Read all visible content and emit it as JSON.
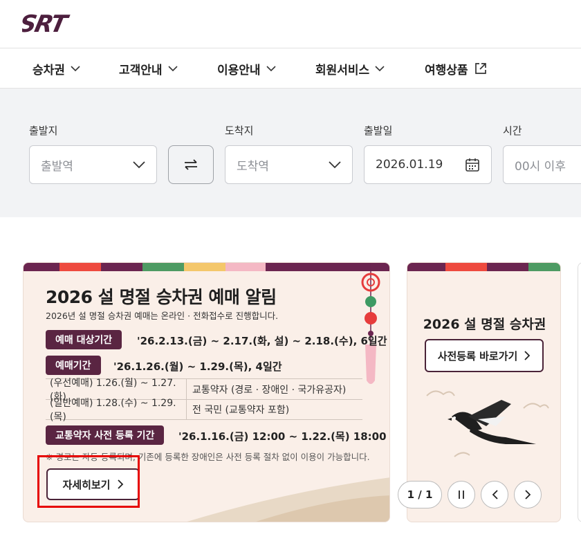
{
  "brand": {
    "logo_text": "SRT",
    "logo_color": "#4d1f3e"
  },
  "gnb": [
    {
      "label": "승차권",
      "icon": "chevron-down-icon"
    },
    {
      "label": "고객안내",
      "icon": "chevron-down-icon"
    },
    {
      "label": "이용안내",
      "icon": "chevron-down-icon"
    },
    {
      "label": "회원서비스",
      "icon": "chevron-down-icon"
    },
    {
      "label": "여행상품",
      "icon": "external-link-icon"
    }
  ],
  "search": {
    "departure": {
      "label": "출발지",
      "placeholder": "출발역"
    },
    "arrival": {
      "label": "도착지",
      "placeholder": "도착역"
    },
    "date": {
      "label": "출발일",
      "value": "2026.01.19"
    },
    "time": {
      "label": "시간",
      "placeholder": "00시 이후"
    }
  },
  "banner_main": {
    "title": "2026 설 명절 승차권 예매 알림",
    "subtitle": "2026년 설 명절 승차권 예매는 온라인 · 전화접수로 진행합니다.",
    "target_period_label": "예매 대상기간",
    "target_period_value": "'26.2.13.(금) ~ 2.17.(화, 설) ~ 2.18.(수), 6일간",
    "booking_period_label": "예매기간",
    "booking_period_value": "'26.1.26.(월) ~ 1.29.(목), 4일간",
    "table": [
      {
        "period": "(우선예매) 1.26.(월) ~ 1.27.(화)",
        "target": "교통약자 (경로 · 장애인 · 국가유공자)"
      },
      {
        "period": "(일반예매) 1.28.(수) ~ 1.29.(목)",
        "target": "전 국민 (교통약자 포함)"
      }
    ],
    "registration_label": "교통약자 사전 등록 기간",
    "registration_value": "'26.1.16.(금) 12:00 ~ 1.22.(목) 18:00",
    "notice": "※ 경로는 자동 등록되며, 기존에 등록한 장애인은 사전 등록 절차 없이 이용이 가능합니다.",
    "more_button": "자세히보기"
  },
  "banner_side": {
    "title": "2026 설 명절 승차권",
    "button": "사전등록 바로가기"
  },
  "carousel": {
    "pager": "1 / 1"
  },
  "colors": {
    "accent": "#5a2542",
    "stripes": [
      "#6b2550",
      "#ee4a3e",
      "#6b2550",
      "#4e9b63",
      "#f4c76b",
      "#f4b8c4",
      "#6b2550"
    ]
  }
}
